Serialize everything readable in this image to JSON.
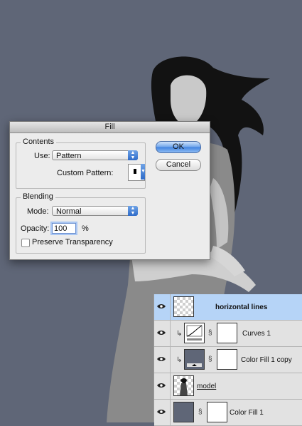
{
  "dialog": {
    "title": "Fill",
    "contents_label": "Contents",
    "use_label": "Use:",
    "use_value": "Pattern",
    "custom_pattern_label": "Custom Pattern:",
    "blending_label": "Blending",
    "mode_label": "Mode:",
    "mode_value": "Normal",
    "opacity_label": "Opacity:",
    "opacity_value": "100",
    "opacity_unit": "%",
    "preserve_transparency_label": "Preserve Transparency",
    "preserve_transparency_checked": false,
    "ok_label": "OK",
    "cancel_label": "Cancel"
  },
  "layers": [
    {
      "name": "horizontal lines",
      "selected": true,
      "thumb": "transparent"
    },
    {
      "name": "Curves 1",
      "selected": false,
      "thumb": "curves",
      "clipped": true
    },
    {
      "name": "Color Fill 1 copy",
      "selected": false,
      "thumb": "color-fill",
      "clipped": true
    },
    {
      "name": "model",
      "selected": false,
      "thumb": "photo"
    },
    {
      "name": "Color Fill 1",
      "selected": false,
      "thumb": "color-fill"
    }
  ],
  "colors": {
    "canvas_background": "#5f6677",
    "selected_layer": "#b6d4f7",
    "default_button": "#3f82e0"
  }
}
